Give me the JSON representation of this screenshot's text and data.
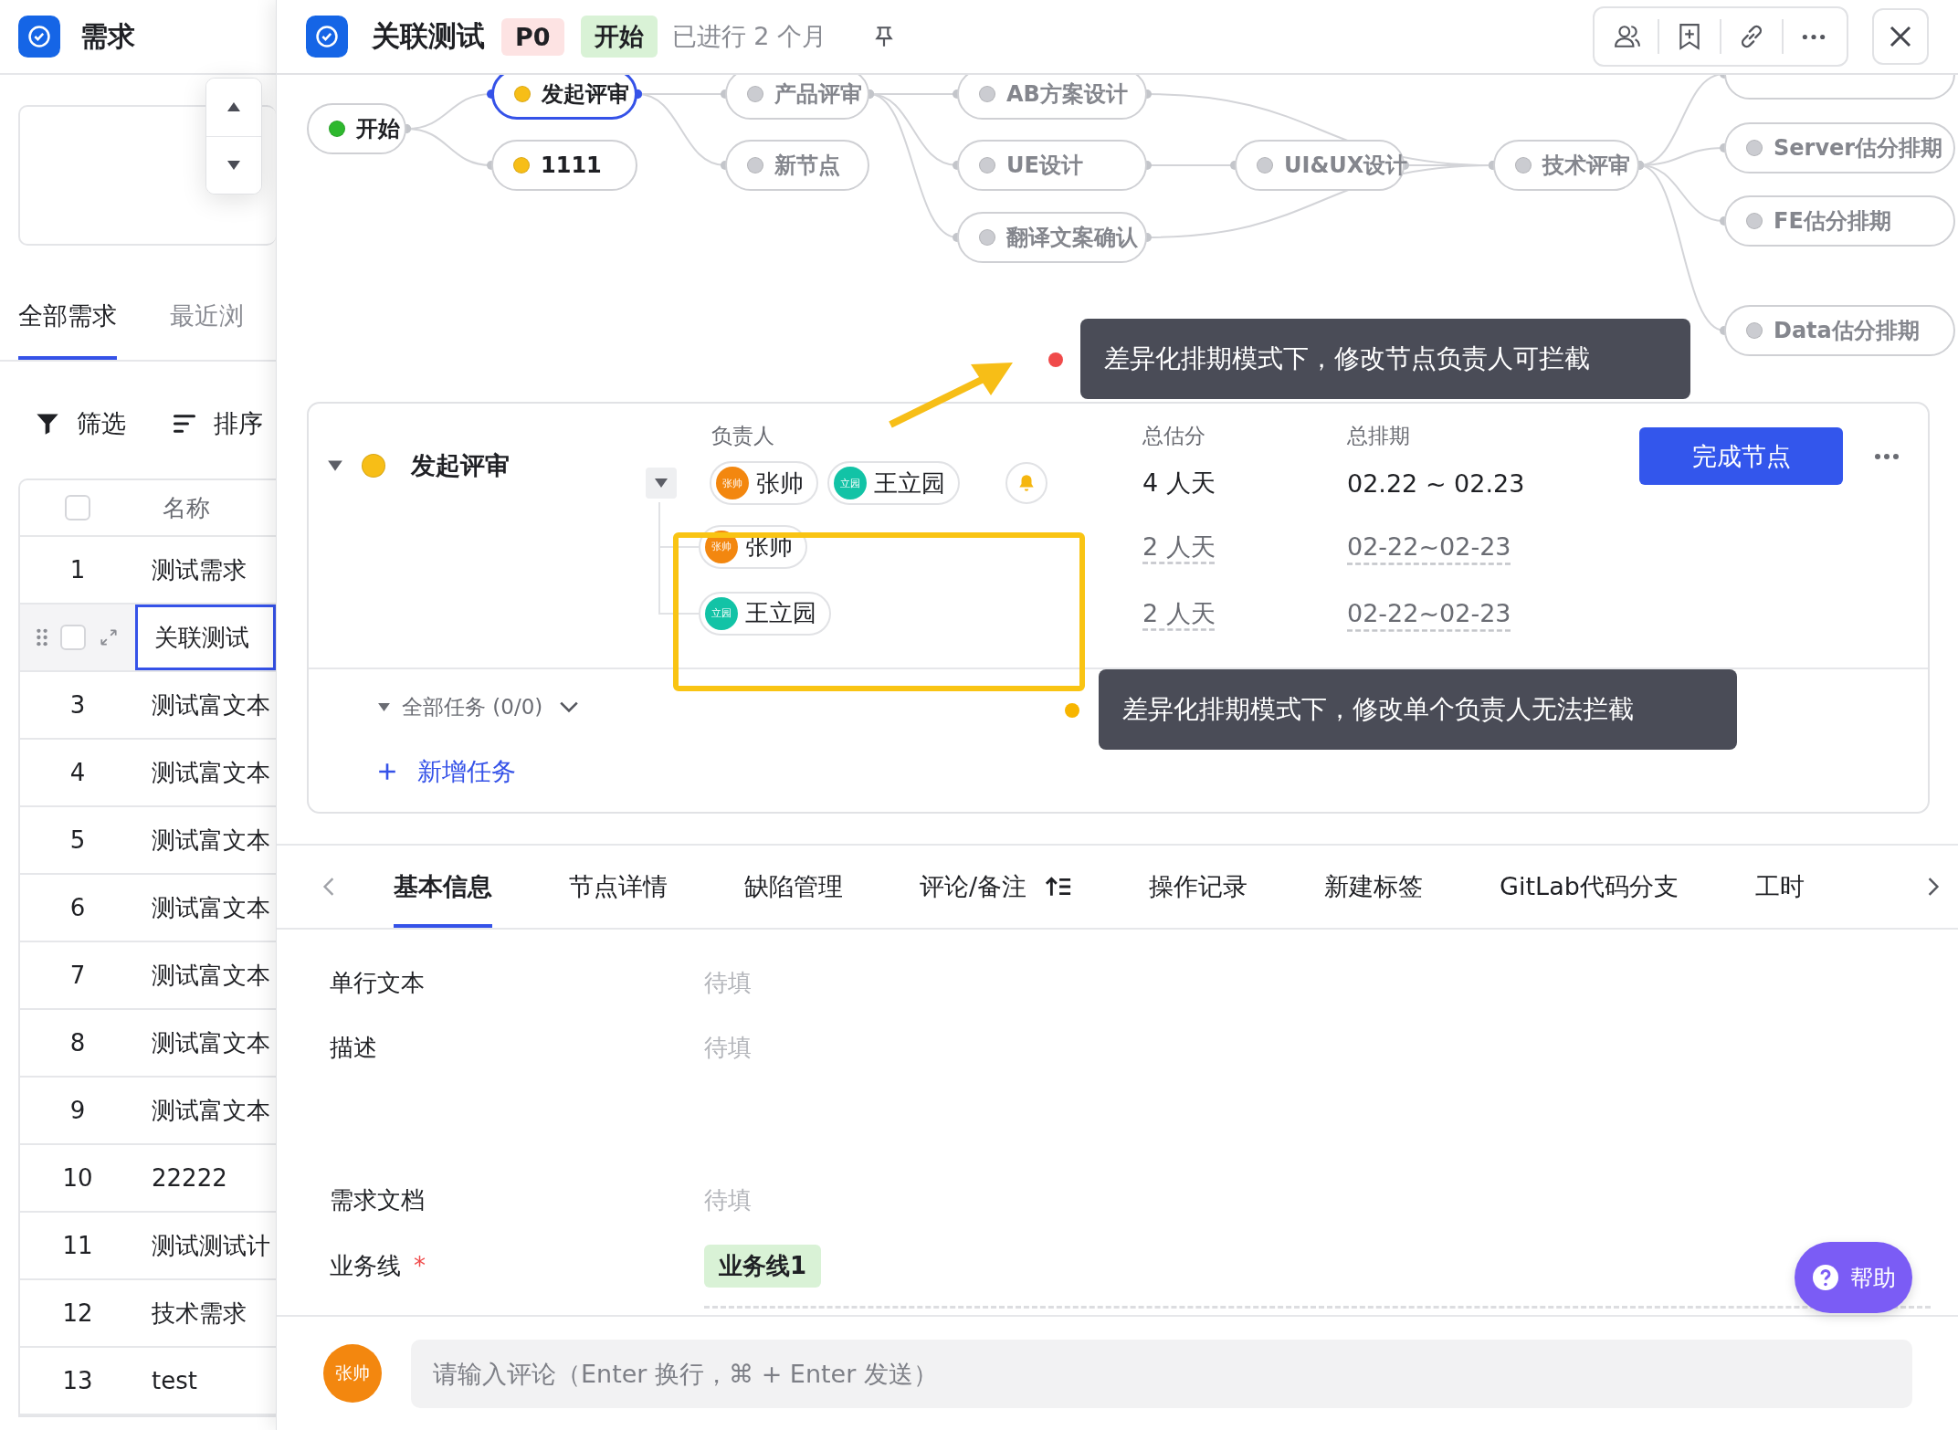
{
  "sidebar": {
    "title": "需求",
    "tabs": [
      {
        "label": "全部需求",
        "selected": true
      },
      {
        "label": "最近浏",
        "selected": false
      }
    ],
    "toolbar": [
      "筛选",
      "排序"
    ],
    "table": {
      "header_checked": false,
      "columns": [
        "名称"
      ],
      "rows": [
        {
          "index": "1",
          "name": "测试需求",
          "selected": false
        },
        {
          "name": "关联测试",
          "selected": true
        },
        {
          "index": "3",
          "name": "测试富文本",
          "selected": false
        },
        {
          "index": "4",
          "name": "测试富文本",
          "selected": false
        },
        {
          "index": "5",
          "name": "测试富文本",
          "selected": false
        },
        {
          "index": "6",
          "name": "测试富文本",
          "selected": false
        },
        {
          "index": "7",
          "name": "测试富文本",
          "selected": false
        },
        {
          "index": "8",
          "name": "测试富文本",
          "selected": false
        },
        {
          "index": "9",
          "name": "测试富文本",
          "selected": false
        },
        {
          "index": "10",
          "name": "22222",
          "selected": false
        },
        {
          "index": "11",
          "name": "测试测试计",
          "selected": false
        },
        {
          "index": "12",
          "name": "技术需求",
          "selected": false
        },
        {
          "index": "13",
          "name": "test",
          "selected": false
        }
      ]
    }
  },
  "detail": {
    "title": "关联测试",
    "priority": "P0",
    "status": "开始",
    "elapsed": "已进行 2 个月"
  },
  "flow": {
    "nodes": [
      {
        "label": "开始",
        "kind": "done",
        "selected": false
      },
      {
        "label": "发起评审",
        "kind": "active",
        "selected": true
      },
      {
        "label": "1111",
        "kind": "active",
        "selected": false
      },
      {
        "label": "产品评审",
        "kind": "pending",
        "selected": false
      },
      {
        "label": "新节点",
        "kind": "pending",
        "selected": false
      },
      {
        "label": "AB方案设计",
        "kind": "pending",
        "selected": false
      },
      {
        "label": "UE设计",
        "kind": "pending",
        "selected": false
      },
      {
        "label": "翻译文案确认",
        "kind": "pending",
        "selected": false
      },
      {
        "label": "UI&UX设计",
        "kind": "pending",
        "selected": false
      },
      {
        "label": "技术评审",
        "kind": "pending",
        "selected": false
      },
      {
        "label": "Server估分排期",
        "kind": "pending",
        "selected": false
      },
      {
        "label": "FE估分排期",
        "kind": "pending",
        "selected": false
      },
      {
        "label": "Data估分排期",
        "kind": "pending",
        "selected": false
      }
    ]
  },
  "annotations": [
    {
      "text": "差异化排期模式下，修改节点负责人可拦截",
      "color": "#f04a4a"
    },
    {
      "text": "差异化排期模式下，修改单个负责人无法拦截",
      "color": "#f7b500"
    }
  ],
  "node_card": {
    "expanded": true,
    "kind": "active",
    "name": "发起评审",
    "columns": [
      "负责人",
      "总估分",
      "总排期"
    ],
    "assignees": [
      {
        "name": "张帅",
        "avatar": "张帅",
        "color": "#f3870f"
      },
      {
        "name": "王立园",
        "avatar": "立园",
        "color": "#12c3a6"
      }
    ],
    "total_estimate": "4 人天",
    "total_schedule": "02.22 ~ 02.23",
    "complete_button": "完成节点",
    "rows": [
      {
        "name": "张帅",
        "avatar": "张帅",
        "color": "#f3870f",
        "estimate": "2 人天",
        "schedule": "02-22~02-23"
      },
      {
        "name": "王立园",
        "avatar": "立园",
        "color": "#12c3a6",
        "estimate": "2 人天",
        "schedule": "02-22~02-23"
      }
    ],
    "tasks_label": "全部任务 (0/0)",
    "add_task": "新增任务"
  },
  "tabs": [
    {
      "label": "基本信息",
      "selected": true,
      "kind": "plain"
    },
    {
      "label": "节点详情",
      "selected": false,
      "kind": "plain"
    },
    {
      "label": "缺陷管理",
      "selected": false,
      "kind": "plain"
    },
    {
      "label": "评论/备注",
      "selected": false,
      "kind": "sortable"
    },
    {
      "label": "操作记录",
      "selected": false,
      "kind": "plain"
    },
    {
      "label": "新建标签",
      "selected": false,
      "kind": "plain"
    },
    {
      "label": "GitLab代码分支",
      "selected": false,
      "kind": "plain"
    },
    {
      "label": "工时",
      "selected": false,
      "kind": "plain"
    }
  ],
  "fields": [
    {
      "label": "单行文本",
      "kind": "text",
      "placeholder": "待填"
    },
    {
      "label": "描述",
      "kind": "multiline",
      "placeholder": "待填"
    },
    {
      "label": "需求文档",
      "kind": "text",
      "placeholder": "待填"
    },
    {
      "label": "业务线",
      "kind": "tag",
      "required_mark": "*",
      "value": "业务线1"
    }
  ],
  "help": "帮助",
  "comment": {
    "avatar": "张帅",
    "placeholder": "请输入评论（Enter 换行，⌘ + Enter 发送）"
  }
}
